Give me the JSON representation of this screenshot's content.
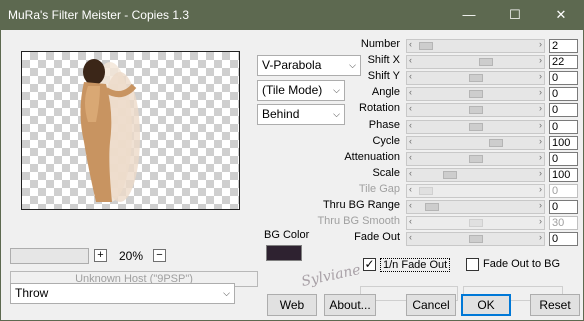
{
  "window": {
    "title": "MuRa's Filter Meister - Copies 1.3",
    "minimize": "—",
    "maximize": "☐",
    "close": "✕"
  },
  "preview": {
    "zoom_minus": "+",
    "zoom_value": "20%",
    "zoom_plus": "−",
    "host_text": "Unknown Host (\"9PSP\")"
  },
  "dropdowns": {
    "mode": "V-Parabola",
    "tile_mode": "(Tile Mode)",
    "layer": "Behind",
    "throw": "Throw"
  },
  "bg_color": {
    "label": "BG Color",
    "value": "#2e2230"
  },
  "params": [
    {
      "label": "Number",
      "value": "2",
      "level": 0.02,
      "enabled": true
    },
    {
      "label": "Shift X",
      "value": "22",
      "level": 0.6,
      "enabled": true
    },
    {
      "label": "Shift Y",
      "value": "0",
      "level": 0.5,
      "enabled": true
    },
    {
      "label": "Angle",
      "value": "0",
      "level": 0.5,
      "enabled": true
    },
    {
      "label": "Rotation",
      "value": "0",
      "level": 0.5,
      "enabled": true
    },
    {
      "label": "Phase",
      "value": "0",
      "level": 0.5,
      "enabled": true
    },
    {
      "label": "Cycle",
      "value": "100",
      "level": 0.7,
      "enabled": true
    },
    {
      "label": "Attenuation",
      "value": "0",
      "level": 0.5,
      "enabled": true
    },
    {
      "label": "Scale",
      "value": "100",
      "level": 0.25,
      "enabled": true
    },
    {
      "label": "Tile Gap",
      "value": "0",
      "level": 0.02,
      "enabled": false
    },
    {
      "label": "Thru BG Range",
      "value": "0",
      "level": 0.08,
      "enabled": true
    },
    {
      "label": "Thru BG Smooth",
      "value": "30",
      "level": 0.5,
      "enabled": false
    },
    {
      "label": "Fade Out",
      "value": "0",
      "level": 0.5,
      "enabled": true
    }
  ],
  "options": {
    "one_over_n_fade_out": {
      "label": "1/n Fade Out",
      "checked": true,
      "mark": "✓"
    },
    "fade_out_to_bg": {
      "label": "Fade Out to BG",
      "checked": false,
      "mark": ""
    }
  },
  "buttons": {
    "web": "Web",
    "about": "About...",
    "cancel": "Cancel",
    "ok": "OK",
    "reset": "Reset"
  },
  "watermark": "Sylviane"
}
